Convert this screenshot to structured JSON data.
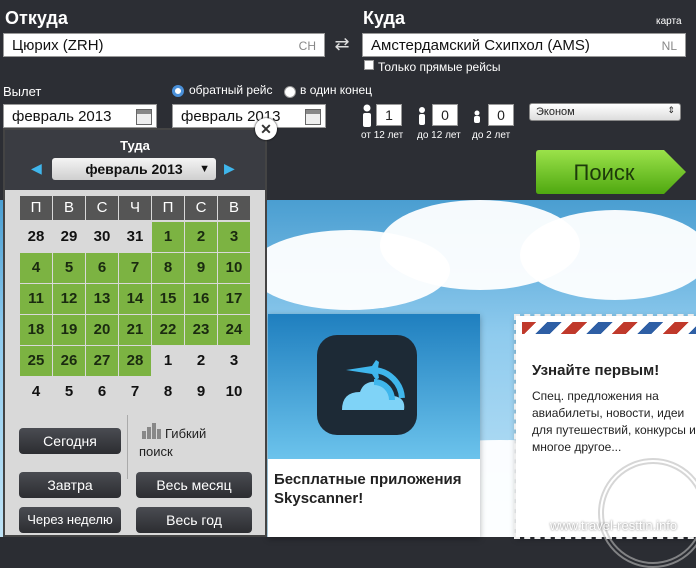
{
  "from": {
    "label": "Откуда",
    "value": "Цюрих (ZRH)",
    "code": "CH"
  },
  "to": {
    "label": "Куда",
    "value": "Амстердамский Схипхол (AMS)",
    "code": "NL",
    "map_label": "карта"
  },
  "direct_only": "Только прямые рейсы",
  "departure": {
    "label": "Вылет",
    "value": "февраль 2013"
  },
  "return": {
    "value": "февраль 2013"
  },
  "trip_type": {
    "round": "обратный рейс",
    "oneway": "в один конец"
  },
  "passengers": {
    "adults": {
      "value": "1",
      "label": "от 12 лет"
    },
    "children": {
      "value": "0",
      "label": "до 12 лет"
    },
    "infants": {
      "value": "0",
      "label": "до 2 лет"
    }
  },
  "cabin": "Эконом",
  "search_label": "Поиск",
  "calendar": {
    "title": "Туда",
    "month": "февраль 2013",
    "close": "✕",
    "prev": "◀",
    "next": "▶",
    "weekdays": [
      "П",
      "В",
      "С",
      "Ч",
      "П",
      "С",
      "В"
    ],
    "weeks": [
      [
        "28",
        "29",
        "30",
        "31",
        "1",
        "2",
        "3"
      ],
      [
        "4",
        "5",
        "6",
        "7",
        "8",
        "9",
        "10"
      ],
      [
        "11",
        "12",
        "13",
        "14",
        "15",
        "16",
        "17"
      ],
      [
        "18",
        "19",
        "20",
        "21",
        "22",
        "23",
        "24"
      ],
      [
        "25",
        "26",
        "27",
        "28",
        "1",
        "2",
        "3"
      ],
      [
        "4",
        "5",
        "6",
        "7",
        "8",
        "9",
        "10"
      ]
    ],
    "in_month": [
      [
        false,
        false,
        false,
        false,
        true,
        true,
        true
      ],
      [
        true,
        true,
        true,
        true,
        true,
        true,
        true
      ],
      [
        true,
        true,
        true,
        true,
        true,
        true,
        true
      ],
      [
        true,
        true,
        true,
        true,
        true,
        true,
        true
      ],
      [
        true,
        true,
        true,
        true,
        false,
        false,
        false
      ],
      [
        false,
        false,
        false,
        false,
        false,
        false,
        false
      ]
    ],
    "today": "Сегодня",
    "flexible": "Гибкий поиск",
    "tomorrow": "Завтра",
    "whole_month": "Весь месяц",
    "in_a_week": "Через неделю",
    "whole_year": "Весь год"
  },
  "promo_app": {
    "text": "Бесплатные приложения Skyscanner!"
  },
  "promo_news": {
    "title": "Узнайте первым!",
    "body": "Спец. предложения на авиабилеты, новости, идеи для путешествий, конкурсы и многое другое..."
  },
  "watermark": "www.travel-resttin.info",
  "colors": {
    "accent_green": "#7cb342",
    "search_green": "#6ecb1e",
    "dark": "#2c2e34"
  }
}
